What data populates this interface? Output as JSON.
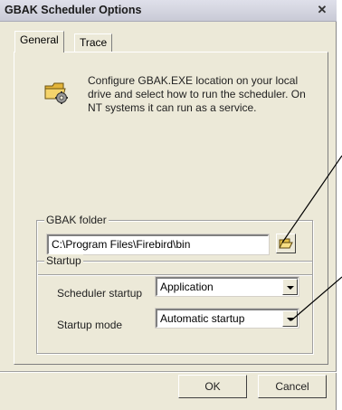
{
  "window": {
    "title": "GBAK Scheduler Options",
    "close_label": "✕"
  },
  "tabs": [
    {
      "label": "General",
      "active": true
    },
    {
      "label": "Trace",
      "active": false
    }
  ],
  "info": {
    "icon": "gear-folder-icon",
    "text": "Configure GBAK.EXE location on your local drive and select how to run the scheduler. On NT systems it can run as a service."
  },
  "gbak_folder": {
    "group_label": "GBAK folder",
    "path": "C:\\Program Files\\Firebird\\bin",
    "browse_icon": "folder-open-icon"
  },
  "startup": {
    "group_label": "Startup",
    "scheduler_label": "Scheduler startup",
    "scheduler_value": "Application",
    "mode_label": "Startup mode",
    "mode_value": "Automatic startup"
  },
  "buttons": {
    "ok": "OK",
    "cancel": "Cancel"
  }
}
